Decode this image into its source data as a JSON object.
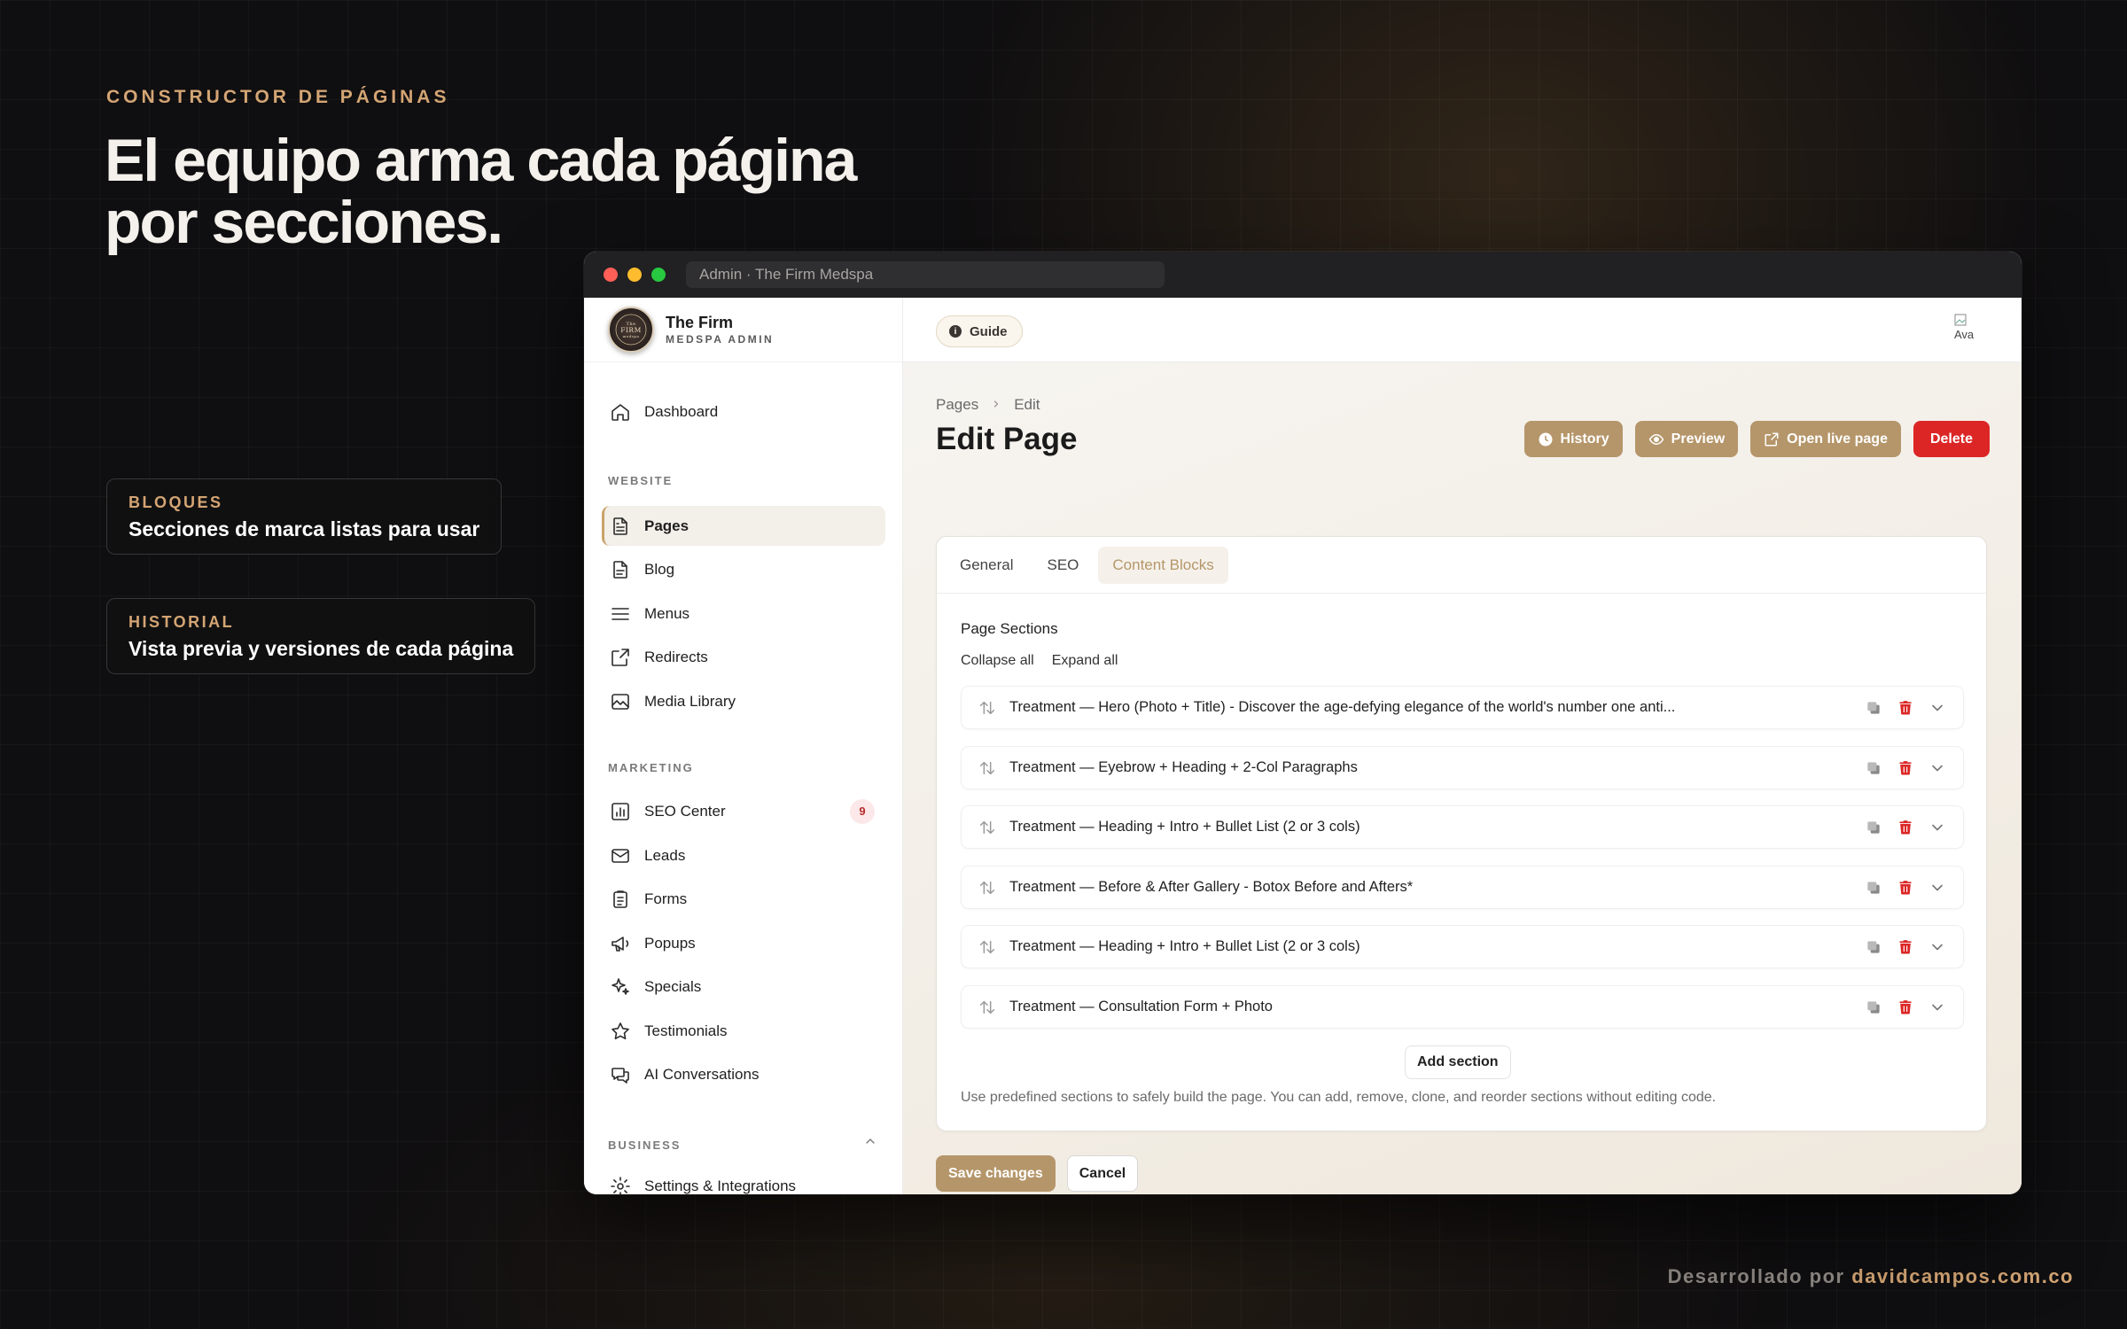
{
  "slide": {
    "eyebrow": "CONSTRUCTOR DE PÁGINAS",
    "headline": "El equipo arma cada página por secciones.",
    "callouts": [
      {
        "key": "BLOQUES",
        "value": "Secciones de marca listas para usar"
      },
      {
        "key": "HISTORIAL",
        "value": "Vista previa y versiones de cada página"
      }
    ],
    "credit_prefix": "Desarrollado por",
    "credit_site": "davidcampos.com.co"
  },
  "window": {
    "tab_title": "Admin · The Firm Medspa"
  },
  "brand": {
    "name": "The Firm",
    "subtitle": "MEDSPA ADMIN",
    "logo_text": "The FIRM medspa"
  },
  "sidebar": {
    "dashboard": "Dashboard",
    "website_label": "WEBSITE",
    "website_items": [
      "Pages",
      "Blog",
      "Menus",
      "Redirects",
      "Media Library"
    ],
    "marketing_label": "MARKETING",
    "marketing_items": [
      "SEO Center",
      "Leads",
      "Forms",
      "Popups",
      "Specials",
      "Testimonials",
      "AI Conversations"
    ],
    "seo_badge": "9",
    "business_label": "BUSINESS",
    "business_items": [
      "Settings & Integrations"
    ],
    "active_item": "Pages"
  },
  "topbar": {
    "guide": "Guide",
    "avatar_alt": "Ava"
  },
  "page": {
    "breadcrumb": [
      "Pages",
      "Edit"
    ],
    "title": "Edit Page",
    "actions": {
      "history": "History",
      "preview": "Preview",
      "open_live": "Open live page",
      "delete": "Delete"
    },
    "tabs": [
      "General",
      "SEO",
      "Content Blocks"
    ],
    "active_tab": "Content Blocks",
    "sections_title": "Page Sections",
    "collapse_all": "Collapse all",
    "expand_all": "Expand all",
    "sections": [
      "Treatment — Hero (Photo + Title) - Discover the age-defying elegance of the world's number one anti...",
      "Treatment — Eyebrow + Heading + 2-Col Paragraphs",
      "Treatment — Heading + Intro + Bullet List (2 or 3 cols)",
      "Treatment — Before & After Gallery - Botox Before and Afters*",
      "Treatment — Heading + Intro + Bullet List (2 or 3 cols)",
      "Treatment — Consultation Form + Photo"
    ],
    "add_section": "Add section",
    "help_text": "Use predefined sections to safely build the page. You can add, remove, clone, and reorder sections without editing code.",
    "save": "Save changes",
    "cancel": "Cancel"
  },
  "colors": {
    "accent": "#b5966a",
    "eyebrow": "#d4a574",
    "danger": "#dc2626"
  }
}
